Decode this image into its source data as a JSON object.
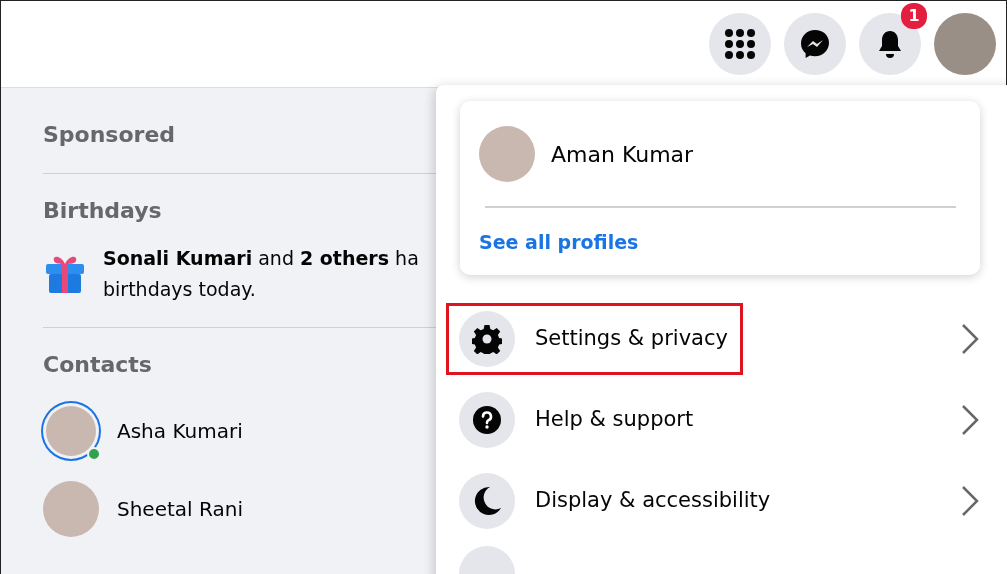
{
  "top_bar": {
    "buttons": [
      {
        "kind": "apps"
      },
      {
        "kind": "messenger"
      },
      {
        "kind": "notifications",
        "badge": "1"
      },
      {
        "kind": "avatar"
      }
    ]
  },
  "sidebar": {
    "sponsored_heading": "Sponsored",
    "birthdays_heading": "Birthdays",
    "birthday_lines": [
      "**Sonali Kumari** and **2 others** ha",
      "birthdays today."
    ],
    "contacts_heading": "Contacts",
    "contacts": [
      {
        "name": "Asha Kumari",
        "story_ring": true,
        "online": true
      },
      {
        "name": "Sheetal Rani",
        "story_ring": false,
        "online": false
      }
    ]
  },
  "account_menu": {
    "profile": {
      "name": "Aman Kumar",
      "link": "See all profiles"
    },
    "items": [
      {
        "kind": "settings",
        "label": "Settings & privacy",
        "highlighted": true
      },
      {
        "kind": "help",
        "label": "Help & support",
        "highlighted": false
      },
      {
        "kind": "display",
        "label": "Display & accessibility",
        "highlighted": false
      },
      {
        "kind": "partial"
      }
    ]
  }
}
